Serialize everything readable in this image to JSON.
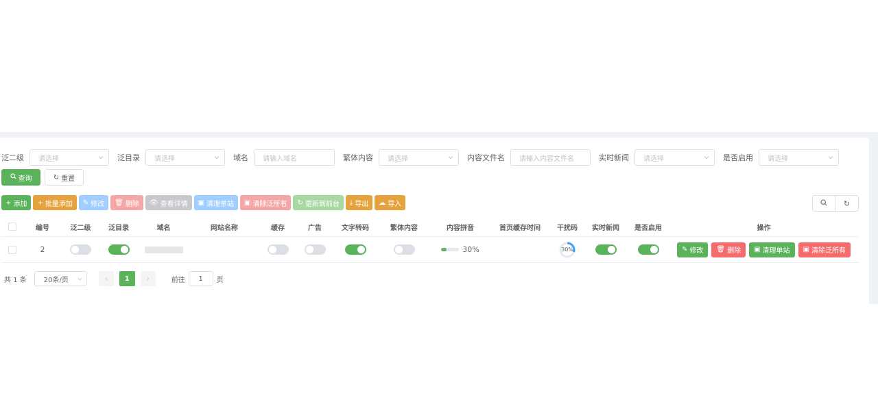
{
  "filters": [
    {
      "label": "泛二级",
      "type": "select",
      "placeholder": "请选择",
      "width": 116
    },
    {
      "label": "泛目录",
      "type": "select",
      "placeholder": "请选择",
      "width": 116
    },
    {
      "label": "域名",
      "type": "input",
      "placeholder": "请输入域名",
      "width": 118
    },
    {
      "label": "繁体内容",
      "type": "select",
      "placeholder": "请选择",
      "width": 117
    },
    {
      "label": "内容文件名",
      "type": "input",
      "placeholder": "请输入内容文件名",
      "width": 117
    },
    {
      "label": "实时新闻",
      "type": "select",
      "placeholder": "请选择",
      "width": 117
    },
    {
      "label": "是否启用",
      "type": "select",
      "placeholder": "请选择",
      "width": 117
    }
  ],
  "search": {
    "query_label": "查询",
    "reset_label": "重置"
  },
  "toolbar": [
    {
      "name": "add-button",
      "label": "添加",
      "icon": "+",
      "color": "#5ab25a"
    },
    {
      "name": "batch-add-button",
      "label": "批量添加",
      "icon": "+",
      "color": "#e6a23c"
    },
    {
      "name": "edit-button",
      "label": "修改",
      "icon": "✎",
      "color": "#a0cfff"
    },
    {
      "name": "delete-button",
      "label": "删除",
      "icon": "🗑",
      "color": "#f5a7a7"
    },
    {
      "name": "view-detail-button",
      "label": "查看详情",
      "icon": "👁",
      "color": "#c8c9cc"
    },
    {
      "name": "clear-single-button",
      "label": "清理单站",
      "icon": "▣",
      "color": "#a0cfff"
    },
    {
      "name": "clear-all-button",
      "label": "清除泛所有",
      "icon": "▣",
      "color": "#f5a7a7"
    },
    {
      "name": "update-frontend-button",
      "label": "更新到前台",
      "icon": "↻",
      "color": "#a9d9a3"
    },
    {
      "name": "export-button",
      "label": "导出",
      "icon": "⤓",
      "color": "#e6a23c"
    },
    {
      "name": "import-button",
      "label": "导入",
      "icon": "☁",
      "color": "#e6a23c"
    }
  ],
  "columns": [
    "编号",
    "泛二级",
    "泛目录",
    "域名",
    "网站名称",
    "缓存",
    "广告",
    "文字转码",
    "繁体内容",
    "内容拼音",
    "首页缓存时间",
    "干扰码",
    "实时新闻",
    "是否启用",
    "操作"
  ],
  "rows": [
    {
      "id": "2",
      "fan_level2": false,
      "fan_dir": true,
      "domain": "",
      "site_name": "",
      "cache": false,
      "ads": false,
      "text_transcode": true,
      "traditional": false,
      "pinyin_percent": 30,
      "pinyin_text": "30%",
      "home_cache_time": "",
      "noise_percent": 30,
      "noise_text": "30%",
      "realtime_news": true,
      "enabled": true
    }
  ],
  "row_actions": [
    {
      "name": "row-edit-button",
      "label": "修改",
      "icon": "✎",
      "color": "#5ab25a"
    },
    {
      "name": "row-delete-button",
      "label": "删除",
      "icon": "🗑",
      "color": "#f56c6c"
    },
    {
      "name": "row-clear-single-button",
      "label": "清理单站",
      "icon": "▣",
      "color": "#5ab25a"
    },
    {
      "name": "row-clear-all-button",
      "label": "清除泛所有",
      "icon": "▣",
      "color": "#f56c6c"
    }
  ],
  "pagination": {
    "total_text": "共 1 条",
    "page_size": "20条/页",
    "current_page": "1",
    "goto_prefix": "前往",
    "goto_value": "1",
    "goto_suffix": "页"
  },
  "colors": {
    "primary": "#5ab25a",
    "danger": "#f56c6c",
    "warning": "#e6a23c",
    "border": "#dcdfe6"
  },
  "icons": {
    "search": "search-icon",
    "refresh": "refresh-icon",
    "chevron": "chevron-down-icon"
  }
}
